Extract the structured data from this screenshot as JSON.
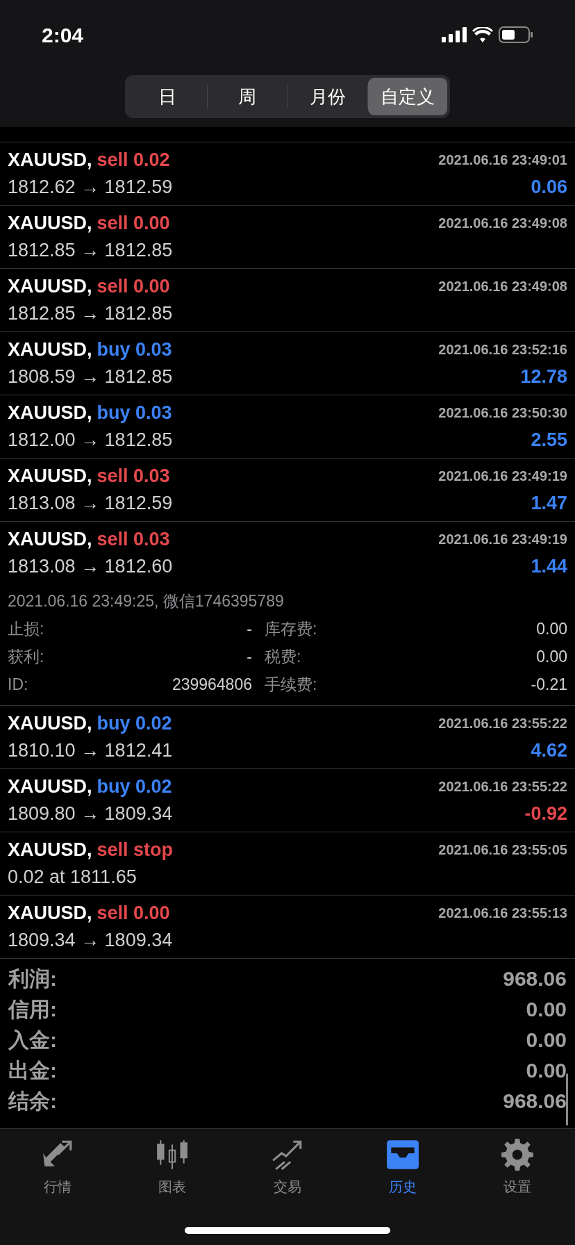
{
  "status_bar": {
    "time": "2:04"
  },
  "period_tabs": [
    {
      "label": "日",
      "selected": false
    },
    {
      "label": "周",
      "selected": false
    },
    {
      "label": "月份",
      "selected": false
    },
    {
      "label": "自定义",
      "selected": true
    }
  ],
  "deals": [
    {
      "symbol": "XAUUSD,",
      "kind": "sell",
      "action": "sell 0.02",
      "time": "2021.06.16 23:49:01",
      "prices": "1812.62 → 1812.59",
      "profit": "0.06",
      "loss": false,
      "expanded": false
    },
    {
      "symbol": "XAUUSD,",
      "kind": "sell",
      "action": "sell 0.00",
      "time": "2021.06.16 23:49:08",
      "prices": "1812.85 → 1812.85",
      "expanded": false
    },
    {
      "symbol": "XAUUSD,",
      "kind": "sell",
      "action": "sell 0.00",
      "time": "2021.06.16 23:49:08",
      "prices": "1812.85 → 1812.85",
      "expanded": false
    },
    {
      "symbol": "XAUUSD,",
      "kind": "buy",
      "action": "buy 0.03",
      "time": "2021.06.16 23:52:16",
      "prices": "1808.59 → 1812.85",
      "profit": "12.78",
      "loss": false,
      "expanded": false
    },
    {
      "symbol": "XAUUSD,",
      "kind": "buy",
      "action": "buy 0.03",
      "time": "2021.06.16 23:50:30",
      "prices": "1812.00 → 1812.85",
      "profit": "2.55",
      "loss": false,
      "expanded": false
    },
    {
      "symbol": "XAUUSD,",
      "kind": "sell",
      "action": "sell 0.03",
      "time": "2021.06.16 23:49:19",
      "prices": "1813.08 → 1812.59",
      "profit": "1.47",
      "loss": false,
      "expanded": false
    },
    {
      "symbol": "XAUUSD,",
      "kind": "sell",
      "action": "sell 0.03",
      "time": "2021.06.16 23:49:19",
      "prices": "1813.08 → 1812.60",
      "profit": "1.44",
      "loss": false,
      "expanded": true,
      "details": {
        "info": "2021.06.16 23:49:25, 微信1746395789",
        "left_fields": [
          {
            "label": "止损:",
            "value": "-"
          },
          {
            "label": "获利:",
            "value": "-"
          },
          {
            "label": "ID:",
            "value": "239964806"
          }
        ],
        "right_fields": [
          {
            "label": "库存费:",
            "value": "0.00"
          },
          {
            "label": "税费:",
            "value": "0.00"
          },
          {
            "label": "手续费:",
            "value": "-0.21"
          }
        ]
      }
    },
    {
      "symbol": "XAUUSD,",
      "kind": "buy",
      "action": "buy 0.02",
      "time": "2021.06.16 23:55:22",
      "prices": "1810.10 → 1812.41",
      "profit": "4.62",
      "loss": false,
      "expanded": false
    },
    {
      "symbol": "XAUUSD,",
      "kind": "buy",
      "action": "buy 0.02",
      "time": "2021.06.16 23:55:22",
      "prices": "1809.80 → 1809.34",
      "profit": "-0.92",
      "loss": true,
      "expanded": false
    },
    {
      "symbol": "XAUUSD,",
      "kind": "sell",
      "action": "sell stop",
      "time": "2021.06.16 23:55:05",
      "prices": "0.02 at 1811.65",
      "expanded": false
    },
    {
      "symbol": "XAUUSD,",
      "kind": "sell",
      "action": "sell 0.00",
      "time": "2021.06.16 23:55:13",
      "prices": "1809.34 → 1809.34",
      "expanded": false
    }
  ],
  "summary": [
    {
      "label": "利润:",
      "value": "968.06"
    },
    {
      "label": "信用:",
      "value": "0.00"
    },
    {
      "label": "入金:",
      "value": "0.00"
    },
    {
      "label": "出金:",
      "value": "0.00"
    },
    {
      "label": "结余:",
      "value": "968.06"
    }
  ],
  "bottom_tabs": [
    {
      "kind": "quotes",
      "label": "行情",
      "selected": false
    },
    {
      "kind": "chart",
      "label": "图表",
      "selected": false
    },
    {
      "kind": "trade",
      "label": "交易",
      "selected": false
    },
    {
      "kind": "history",
      "label": "历史",
      "selected": true
    },
    {
      "kind": "settings",
      "label": "设置",
      "selected": false
    }
  ]
}
